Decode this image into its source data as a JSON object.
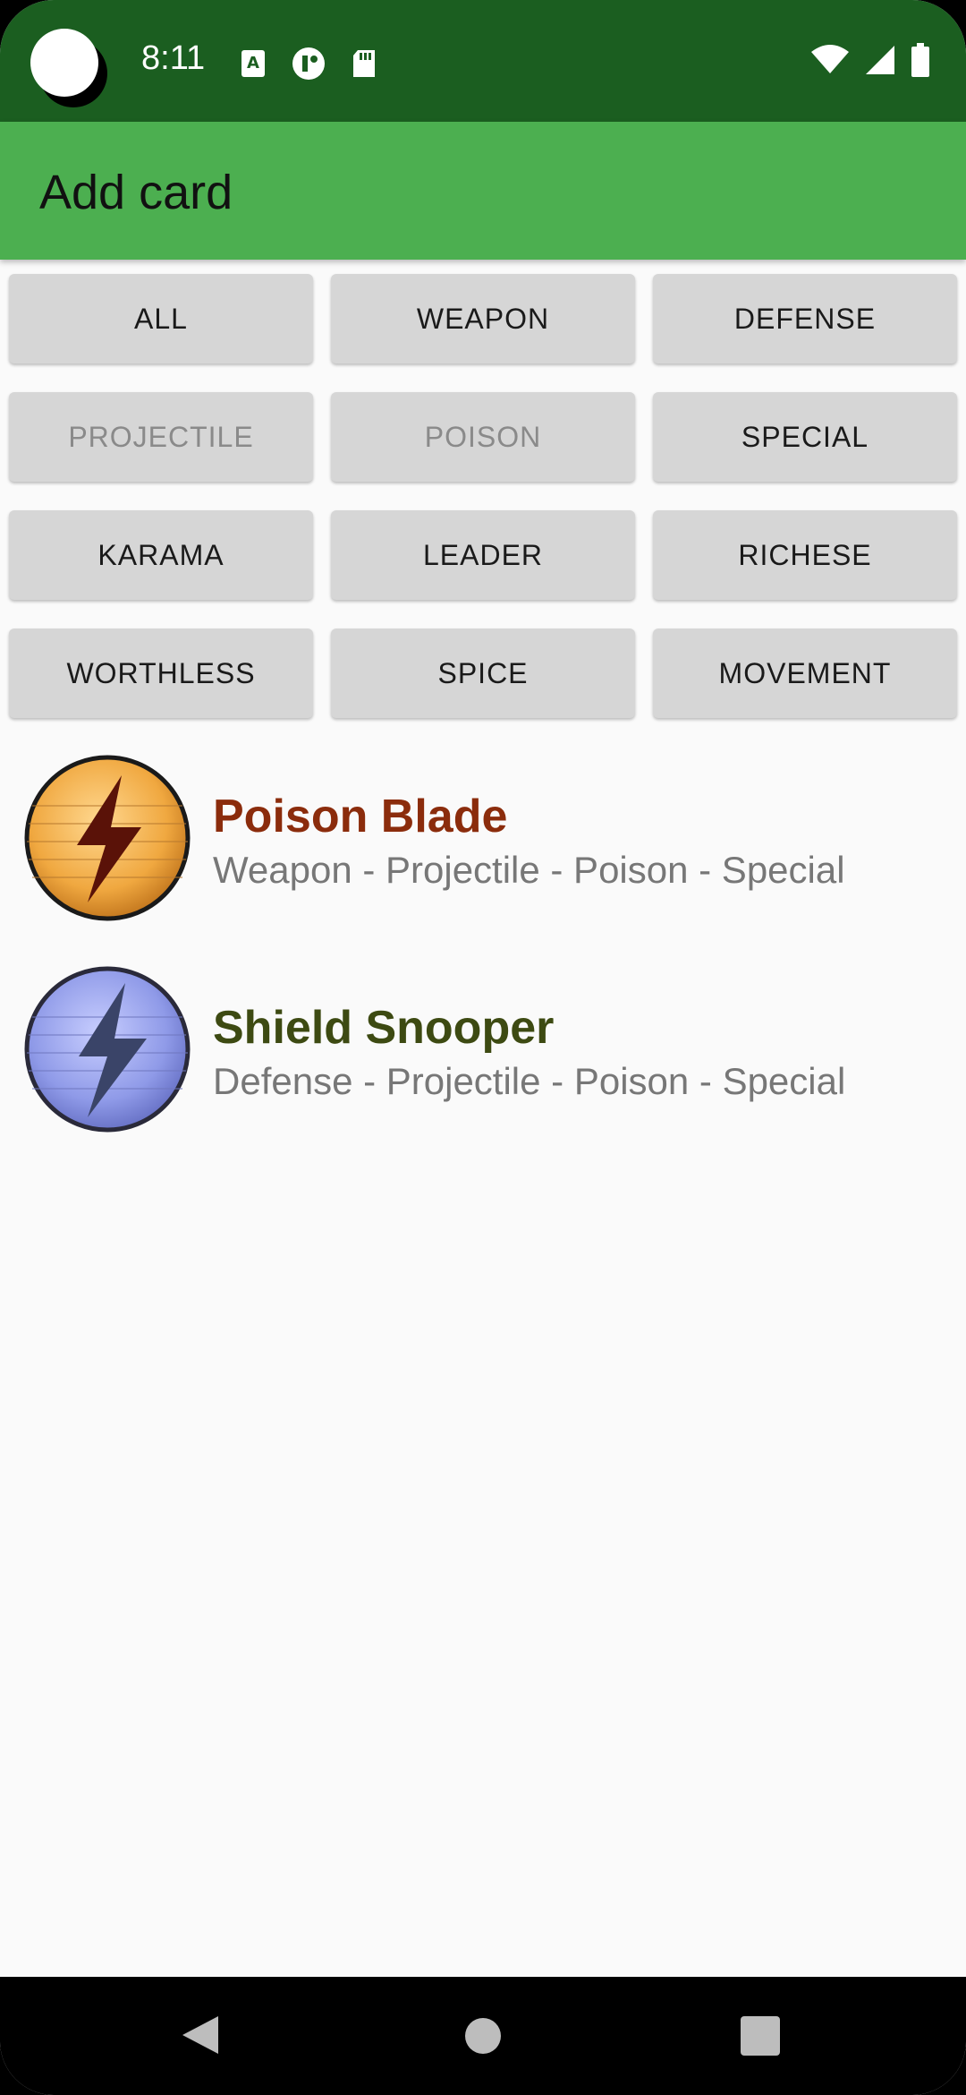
{
  "status_bar": {
    "time": "8:11",
    "left_icons": [
      "accessibility-icon",
      "app-notification-icon",
      "sd-card-icon"
    ],
    "right_icons": [
      "wifi-icon",
      "signal-icon",
      "battery-icon"
    ]
  },
  "app_bar": {
    "title": "Add card"
  },
  "filters": [
    {
      "label": "ALL",
      "enabled": true
    },
    {
      "label": "WEAPON",
      "enabled": true
    },
    {
      "label": "DEFENSE",
      "enabled": true
    },
    {
      "label": "PROJECTILE",
      "enabled": false
    },
    {
      "label": "POISON",
      "enabled": false
    },
    {
      "label": "SPECIAL",
      "enabled": true
    },
    {
      "label": "KARAMA",
      "enabled": true
    },
    {
      "label": "LEADER",
      "enabled": true
    },
    {
      "label": "RICHESE",
      "enabled": true
    },
    {
      "label": "WORTHLESS",
      "enabled": true
    },
    {
      "label": "SPICE",
      "enabled": true
    },
    {
      "label": "MOVEMENT",
      "enabled": true
    }
  ],
  "cards": [
    {
      "name": "Poison Blade",
      "types": "Weapon - Projectile - Poison - Special",
      "name_color": "#8b2c0c",
      "icon": "lightning-weapon-icon",
      "icon_color": "#f0a840"
    },
    {
      "name": "Shield Snooper",
      "types": "Defense - Projectile - Poison - Special",
      "name_color": "#3d4a12",
      "icon": "lightning-defense-icon",
      "icon_color": "#8f9ae8"
    }
  ],
  "nav_bar": {
    "icons": [
      "back-icon",
      "home-icon",
      "recents-icon"
    ]
  }
}
